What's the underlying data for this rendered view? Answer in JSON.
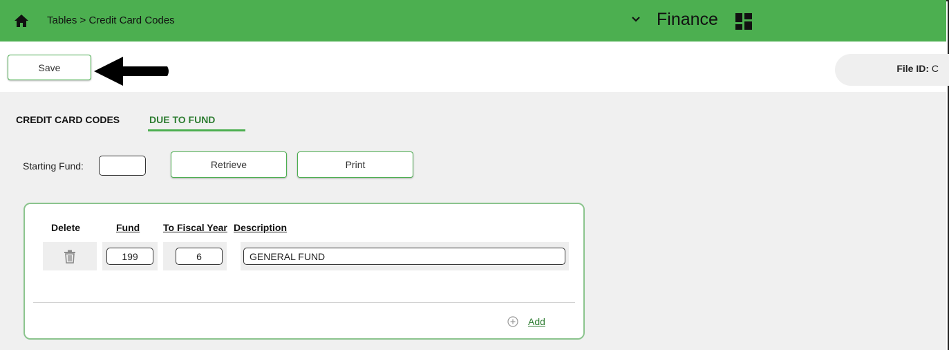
{
  "header": {
    "breadcrumb": "Tables > Credit Card Codes",
    "module": "Finance",
    "icons": [
      "home-icon",
      "chevron-down-icon",
      "app-grid-icon"
    ],
    "bg_color": "#4caf50"
  },
  "toolbar": {
    "save_label": "Save",
    "file_id_label": "File ID:",
    "file_id_value": "C"
  },
  "tabs": [
    {
      "label": "CREDIT CARD CODES",
      "active": false
    },
    {
      "label": "DUE TO FUND",
      "active": true
    }
  ],
  "filter": {
    "starting_fund_label": "Starting Fund:",
    "starting_fund_value": "",
    "retrieve_label": "Retrieve",
    "print_label": "Print"
  },
  "table": {
    "columns": [
      "Delete",
      "Fund",
      "To Fiscal Year",
      "Description"
    ],
    "rows": [
      {
        "fund": "199",
        "to_fiscal_year": "6",
        "description": "GENERAL FUND"
      }
    ],
    "add_label": "Add"
  },
  "colors": {
    "accent": "#4caf50",
    "accent_dark": "#2e7d32",
    "content_bg": "#f0f0f0"
  }
}
